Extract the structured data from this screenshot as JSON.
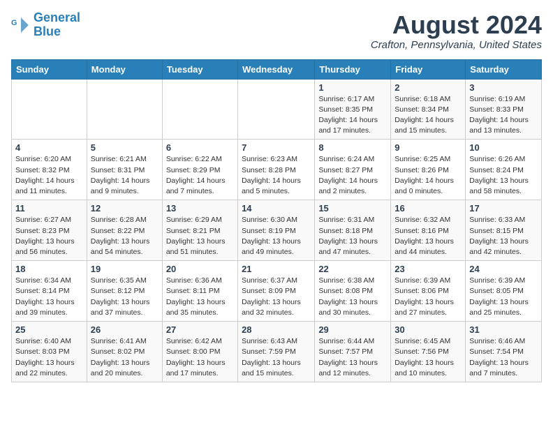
{
  "logo": {
    "line1": "General",
    "line2": "Blue"
  },
  "title": "August 2024",
  "subtitle": "Crafton, Pennsylvania, United States",
  "weekdays": [
    "Sunday",
    "Monday",
    "Tuesday",
    "Wednesday",
    "Thursday",
    "Friday",
    "Saturday"
  ],
  "weeks": [
    [
      {
        "day": "",
        "info": ""
      },
      {
        "day": "",
        "info": ""
      },
      {
        "day": "",
        "info": ""
      },
      {
        "day": "",
        "info": ""
      },
      {
        "day": "1",
        "info": "Sunrise: 6:17 AM\nSunset: 8:35 PM\nDaylight: 14 hours\nand 17 minutes."
      },
      {
        "day": "2",
        "info": "Sunrise: 6:18 AM\nSunset: 8:34 PM\nDaylight: 14 hours\nand 15 minutes."
      },
      {
        "day": "3",
        "info": "Sunrise: 6:19 AM\nSunset: 8:33 PM\nDaylight: 14 hours\nand 13 minutes."
      }
    ],
    [
      {
        "day": "4",
        "info": "Sunrise: 6:20 AM\nSunset: 8:32 PM\nDaylight: 14 hours\nand 11 minutes."
      },
      {
        "day": "5",
        "info": "Sunrise: 6:21 AM\nSunset: 8:31 PM\nDaylight: 14 hours\nand 9 minutes."
      },
      {
        "day": "6",
        "info": "Sunrise: 6:22 AM\nSunset: 8:29 PM\nDaylight: 14 hours\nand 7 minutes."
      },
      {
        "day": "7",
        "info": "Sunrise: 6:23 AM\nSunset: 8:28 PM\nDaylight: 14 hours\nand 5 minutes."
      },
      {
        "day": "8",
        "info": "Sunrise: 6:24 AM\nSunset: 8:27 PM\nDaylight: 14 hours\nand 2 minutes."
      },
      {
        "day": "9",
        "info": "Sunrise: 6:25 AM\nSunset: 8:26 PM\nDaylight: 14 hours\nand 0 minutes."
      },
      {
        "day": "10",
        "info": "Sunrise: 6:26 AM\nSunset: 8:24 PM\nDaylight: 13 hours\nand 58 minutes."
      }
    ],
    [
      {
        "day": "11",
        "info": "Sunrise: 6:27 AM\nSunset: 8:23 PM\nDaylight: 13 hours\nand 56 minutes."
      },
      {
        "day": "12",
        "info": "Sunrise: 6:28 AM\nSunset: 8:22 PM\nDaylight: 13 hours\nand 54 minutes."
      },
      {
        "day": "13",
        "info": "Sunrise: 6:29 AM\nSunset: 8:21 PM\nDaylight: 13 hours\nand 51 minutes."
      },
      {
        "day": "14",
        "info": "Sunrise: 6:30 AM\nSunset: 8:19 PM\nDaylight: 13 hours\nand 49 minutes."
      },
      {
        "day": "15",
        "info": "Sunrise: 6:31 AM\nSunset: 8:18 PM\nDaylight: 13 hours\nand 47 minutes."
      },
      {
        "day": "16",
        "info": "Sunrise: 6:32 AM\nSunset: 8:16 PM\nDaylight: 13 hours\nand 44 minutes."
      },
      {
        "day": "17",
        "info": "Sunrise: 6:33 AM\nSunset: 8:15 PM\nDaylight: 13 hours\nand 42 minutes."
      }
    ],
    [
      {
        "day": "18",
        "info": "Sunrise: 6:34 AM\nSunset: 8:14 PM\nDaylight: 13 hours\nand 39 minutes."
      },
      {
        "day": "19",
        "info": "Sunrise: 6:35 AM\nSunset: 8:12 PM\nDaylight: 13 hours\nand 37 minutes."
      },
      {
        "day": "20",
        "info": "Sunrise: 6:36 AM\nSunset: 8:11 PM\nDaylight: 13 hours\nand 35 minutes."
      },
      {
        "day": "21",
        "info": "Sunrise: 6:37 AM\nSunset: 8:09 PM\nDaylight: 13 hours\nand 32 minutes."
      },
      {
        "day": "22",
        "info": "Sunrise: 6:38 AM\nSunset: 8:08 PM\nDaylight: 13 hours\nand 30 minutes."
      },
      {
        "day": "23",
        "info": "Sunrise: 6:39 AM\nSunset: 8:06 PM\nDaylight: 13 hours\nand 27 minutes."
      },
      {
        "day": "24",
        "info": "Sunrise: 6:39 AM\nSunset: 8:05 PM\nDaylight: 13 hours\nand 25 minutes."
      }
    ],
    [
      {
        "day": "25",
        "info": "Sunrise: 6:40 AM\nSunset: 8:03 PM\nDaylight: 13 hours\nand 22 minutes."
      },
      {
        "day": "26",
        "info": "Sunrise: 6:41 AM\nSunset: 8:02 PM\nDaylight: 13 hours\nand 20 minutes."
      },
      {
        "day": "27",
        "info": "Sunrise: 6:42 AM\nSunset: 8:00 PM\nDaylight: 13 hours\nand 17 minutes."
      },
      {
        "day": "28",
        "info": "Sunrise: 6:43 AM\nSunset: 7:59 PM\nDaylight: 13 hours\nand 15 minutes."
      },
      {
        "day": "29",
        "info": "Sunrise: 6:44 AM\nSunset: 7:57 PM\nDaylight: 13 hours\nand 12 minutes."
      },
      {
        "day": "30",
        "info": "Sunrise: 6:45 AM\nSunset: 7:56 PM\nDaylight: 13 hours\nand 10 minutes."
      },
      {
        "day": "31",
        "info": "Sunrise: 6:46 AM\nSunset: 7:54 PM\nDaylight: 13 hours\nand 7 minutes."
      }
    ]
  ]
}
